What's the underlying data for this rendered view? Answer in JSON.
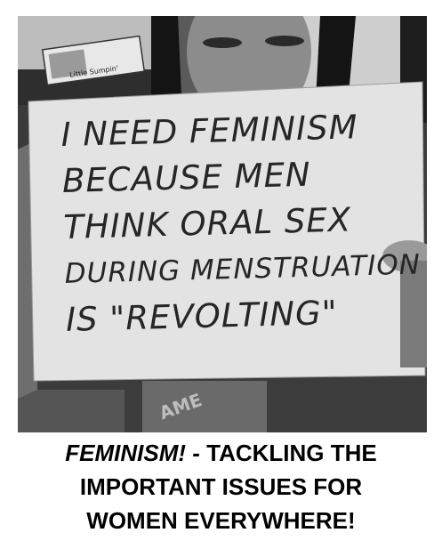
{
  "photo": {
    "product_label": "Little Sumpin'",
    "sign_lines": [
      "I NEED FEMINISM",
      "BECAUSE MEN",
      "THINK ORAL SEX",
      "DURING MENSTRUATION",
      "IS \"REVOLTING\""
    ]
  },
  "caption": {
    "emphasis": "FEMINISM! -",
    "line1_rest": " TACKLING THE",
    "line2": "IMPORTANT ISSUES FOR",
    "line3": "WOMEN EVERYWHERE!"
  }
}
